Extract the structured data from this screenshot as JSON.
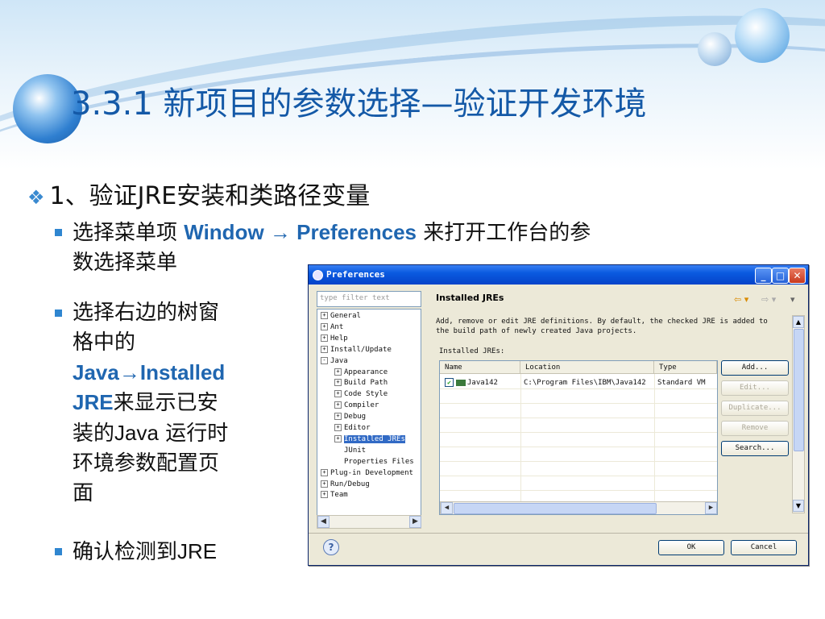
{
  "slide": {
    "title": "3.3.1  新项目的参数选择—验证开发环境",
    "bullet1": "1、验证JRE安装和类路径变量",
    "sub1": {
      "pre": "选择菜单项 ",
      "em": "Window → Preferences",
      "post": " 来打开工作台的参",
      "line2": "数选择菜单"
    },
    "sub2": {
      "l1": "选择右边的树窗",
      "l2": "格中的",
      "em1": "Java→Installed",
      "em2": "JRE",
      "l4": "来显示已安",
      "l5a": "装的",
      "l5b": "Java",
      "l5c": " 运行时",
      "l6": "环境参数配置页",
      "l7": "面"
    },
    "sub3": {
      "pre": "确认检测到",
      "jre": "JRE"
    }
  },
  "dialog": {
    "title": "Preferences",
    "filter_placeholder": "type filter text",
    "tree": [
      {
        "label": "General",
        "toggle": "+"
      },
      {
        "label": "Ant",
        "toggle": "+"
      },
      {
        "label": "Help",
        "toggle": "+"
      },
      {
        "label": "Install/Update",
        "toggle": "+"
      },
      {
        "label": "Java",
        "toggle": "-"
      },
      {
        "label": "Appearance",
        "toggle": "+"
      },
      {
        "label": "Build Path",
        "toggle": "+"
      },
      {
        "label": "Code Style",
        "toggle": "+"
      },
      {
        "label": "Compiler",
        "toggle": "+"
      },
      {
        "label": "Debug",
        "toggle": "+"
      },
      {
        "label": "Editor",
        "toggle": "+"
      },
      {
        "label": "Installed JREs",
        "toggle": "+"
      },
      {
        "label": "JUnit",
        "toggle": ""
      },
      {
        "label": "Properties Files",
        "toggle": ""
      },
      {
        "label": "Plug-in Development",
        "toggle": "+"
      },
      {
        "label": "Run/Debug",
        "toggle": "+"
      },
      {
        "label": "Team",
        "toggle": "+"
      }
    ],
    "panel_title": "Installed JREs",
    "description_l1": "Add, remove or edit JRE definitions. By default, the checked JRE is added to",
    "description_l2": "the build path of newly created Java projects.",
    "installed_label": "Installed JREs:",
    "columns": [
      "Name",
      "Location",
      "Type"
    ],
    "rows": [
      {
        "name": "Java142",
        "location": "C:\\Program Files\\IBM\\Java142",
        "type": "Standard VM",
        "checked": true
      }
    ],
    "side_buttons": {
      "add": "Add...",
      "edit": "Edit...",
      "duplicate": "Duplicate...",
      "remove": "Remove",
      "search": "Search..."
    },
    "ok": "OK",
    "cancel": "Cancel",
    "help_glyph": "?"
  }
}
